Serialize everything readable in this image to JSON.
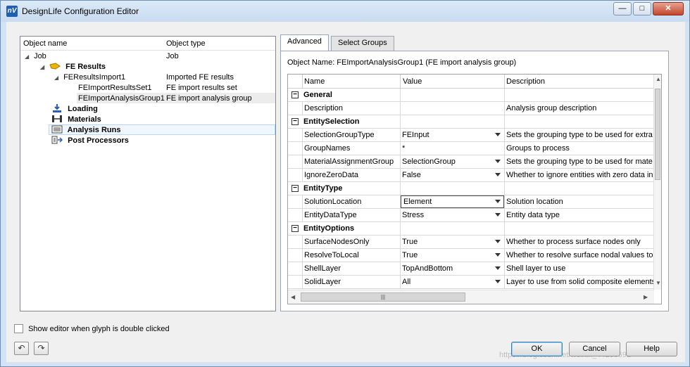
{
  "window": {
    "title": "DesignLife Configuration Editor",
    "app_icon": "nV",
    "controls": {
      "minimize": "—",
      "maximize": "□",
      "close": "✕"
    }
  },
  "tree": {
    "col_name": "Object name",
    "col_type": "Object type",
    "rows": [
      {
        "label": "Job",
        "type": "Job",
        "icon": "expand-triangle"
      },
      {
        "label": "FE Results",
        "type": "",
        "icon": "fe-results-icon"
      },
      {
        "label": "FEResultsImport1",
        "type": "Imported FE results",
        "icon": "expand-triangle"
      },
      {
        "label": "FEImportResultsSet1",
        "type": "FE import results set",
        "icon": ""
      },
      {
        "label": "FEImportAnalysisGroup1",
        "type": "FE import analysis group",
        "icon": ""
      },
      {
        "label": "Loading",
        "type": "",
        "icon": "loading-icon"
      },
      {
        "label": "Materials",
        "type": "",
        "icon": "materials-icon"
      },
      {
        "label": "Analysis Runs",
        "type": "",
        "icon": "analysis-runs-icon"
      },
      {
        "label": "Post Processors",
        "type": "",
        "icon": "post-processors-icon"
      }
    ]
  },
  "tabs": [
    {
      "label": "Advanced"
    },
    {
      "label": "Select Groups"
    }
  ],
  "object_name": "Object Name: FEImportAnalysisGroup1 (FE import analysis group)",
  "grid": {
    "headers": {
      "name": "Name",
      "value": "Value",
      "description": "Description"
    },
    "rows": [
      {
        "cat": true,
        "name": "General",
        "value": "",
        "desc": ""
      },
      {
        "cat": false,
        "name": "Description",
        "value": "",
        "desc": "Analysis group description",
        "dropdown": false
      },
      {
        "cat": true,
        "name": "EntitySelection",
        "value": "",
        "desc": ""
      },
      {
        "cat": false,
        "name": "SelectionGroupType",
        "value": "FEInput",
        "desc": "Sets the grouping type to be used for extra",
        "dropdown": true
      },
      {
        "cat": false,
        "name": "GroupNames",
        "value": "*",
        "desc": "Groups to process",
        "dropdown": false
      },
      {
        "cat": false,
        "name": "MaterialAssignmentGroup",
        "value": "SelectionGroup",
        "desc": "Sets the grouping type to be used for mate",
        "dropdown": true
      },
      {
        "cat": false,
        "name": "IgnoreZeroData",
        "value": "False",
        "desc": "Whether to ignore entities with zero data in",
        "dropdown": true
      },
      {
        "cat": true,
        "name": "EntityType",
        "value": "",
        "desc": ""
      },
      {
        "cat": false,
        "name": "SolutionLocation",
        "value": "Element",
        "desc": "Solution location",
        "dropdown": true,
        "editing": true
      },
      {
        "cat": false,
        "name": "EntityDataType",
        "value": "Stress",
        "desc": "Entity data type",
        "dropdown": true
      },
      {
        "cat": true,
        "name": "EntityOptions",
        "value": "",
        "desc": ""
      },
      {
        "cat": false,
        "name": "SurfaceNodesOnly",
        "value": "True",
        "desc": "Whether to process surface nodes only",
        "dropdown": true
      },
      {
        "cat": false,
        "name": "ResolveToLocal",
        "value": "True",
        "desc": "Whether to resolve surface nodal values to",
        "dropdown": true
      },
      {
        "cat": false,
        "name": "ShellLayer",
        "value": "TopAndBottom",
        "desc": "Shell layer to use",
        "dropdown": true
      },
      {
        "cat": false,
        "name": "SolidLayer",
        "value": "All",
        "desc": "Layer to use from solid composite elements",
        "dropdown": true
      }
    ]
  },
  "footer": {
    "checkbox_label": "Show editor when glyph is double clicked",
    "checkbox_checked": false,
    "undo_icon": "↶",
    "redo_icon": "↷",
    "ok": "OK",
    "cancel": "Cancel",
    "help": "Help",
    "watermark": "https://blog.csdn.net/weixin_44136692"
  }
}
